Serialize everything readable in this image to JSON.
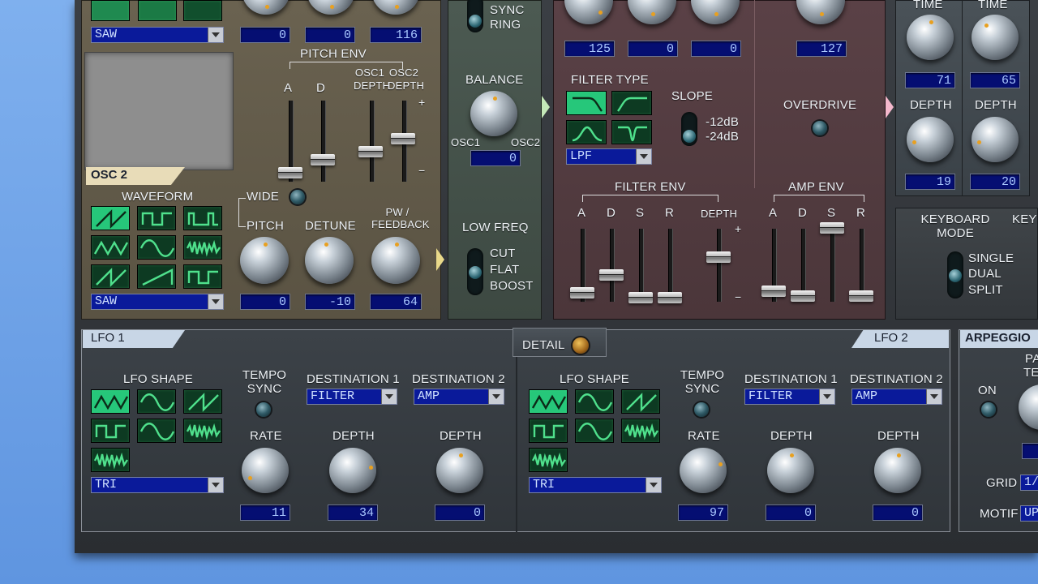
{
  "osc1": {
    "waveform_select": "SAW",
    "values": [
      "0",
      "0",
      "116"
    ]
  },
  "pitch_env": {
    "title": "PITCH ENV",
    "a": "A",
    "d": "D",
    "osc1_depth": "OSC1 DEPTH",
    "osc2_depth": "OSC2 DEPTH",
    "plus": "+",
    "minus": "−"
  },
  "osc2": {
    "title": "OSC 2",
    "waveform_label": "WAVEFORM",
    "wide": "WIDE",
    "pitch": "PITCH",
    "detune": "DETUNE",
    "pw_feedback": "PW / FEEDBACK",
    "waveform_select": "SAW",
    "values": [
      "0",
      "-10",
      "64"
    ]
  },
  "mixer": {
    "sync": "SYNC",
    "ring": "RING",
    "balance": "BALANCE",
    "osc1": "OSC1",
    "osc2": "OSC2",
    "balance_value": "0",
    "low_freq": "LOW FREQ",
    "cut": "CUT",
    "flat": "FLAT",
    "boost": "BOOST"
  },
  "filter": {
    "values": [
      "125",
      "0",
      "0"
    ],
    "filter_type": "FILTER TYPE",
    "slope": "SLOPE",
    "slope_12": "-12dB",
    "slope_24": "-24dB",
    "type_select": "LPF",
    "filter_env": "FILTER ENV",
    "a": "A",
    "d": "D",
    "s": "S",
    "r": "R",
    "depth": "DEPTH",
    "plus": "+",
    "minus": "−"
  },
  "amp": {
    "value": "127",
    "overdrive": "OVERDRIVE",
    "amp_env": "AMP ENV",
    "a": "A",
    "d": "D",
    "s": "S",
    "r": "R"
  },
  "effects": {
    "time1": "TIME",
    "time2": "TIME",
    "time_values": [
      "71",
      "65"
    ],
    "depth1": "DEPTH",
    "depth2": "DEPTH",
    "depth_values": [
      "19",
      "20"
    ]
  },
  "keyboard": {
    "mode": "KEYBOARD MODE",
    "single": "SINGLE",
    "dual": "DUAL",
    "split": "SPLIT",
    "cut_off": "KEY"
  },
  "lfo1": {
    "title": "LFO 1",
    "shape": "LFO SHAPE",
    "tempo_sync": "TEMPO SYNC",
    "dest1": "DESTINATION 1",
    "dest2": "DESTINATION 2",
    "dest1_select": "FILTER",
    "dest2_select": "AMP",
    "rate": "RATE",
    "depth1": "DEPTH",
    "depth2": "DEPTH",
    "shape_select": "TRI",
    "rate_value": "11",
    "depth1_value": "34",
    "depth2_value": "0"
  },
  "detail": "DETAIL",
  "lfo2": {
    "title": "LFO 2",
    "shape": "LFO SHAPE",
    "tempo_sync": "TEMPO SYNC",
    "dest1": "DESTINATION 1",
    "dest2": "DESTINATION 2",
    "dest1_select": "FILTER",
    "dest2_select": "AMP",
    "rate": "RATE",
    "depth1": "DEPTH",
    "depth2": "DEPTH",
    "shape_select": "TRI",
    "rate_value": "97",
    "depth1_value": "0",
    "depth2_value": "0"
  },
  "arpeggio": {
    "title": "ARPEGGIO",
    "on": "ON",
    "pa": "PA",
    "te": "TE",
    "grid": "GRID",
    "grid_value": "1/",
    "motif": "MOTIF",
    "motif_value": "UP"
  }
}
